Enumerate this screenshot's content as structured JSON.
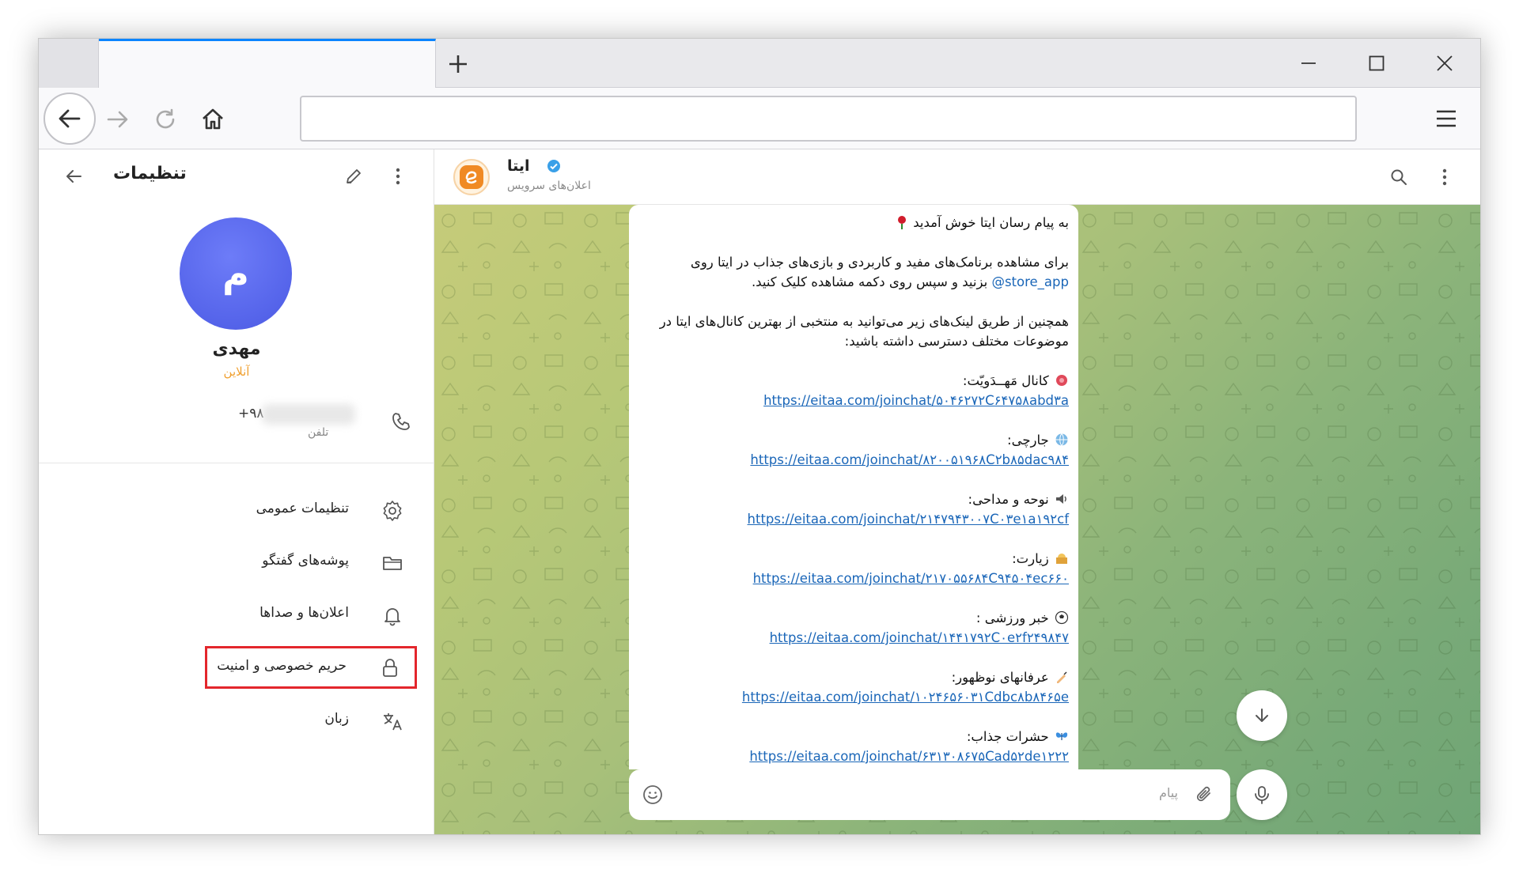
{
  "browser": {
    "new_tab_symbol": "+",
    "address": ""
  },
  "sidebar": {
    "title": "تنظیمات",
    "avatar_letter": "م",
    "user_name": "مهدی",
    "status": "آنلاین",
    "phone_prefix": "+۹۸",
    "phone_label": "تلفن",
    "items": [
      {
        "label": "تنظیمات عمومی",
        "icon": "gear-icon"
      },
      {
        "label": "پوشه‌های گفتگو",
        "icon": "folder-icon"
      },
      {
        "label": "اعلان‌ها و صداها",
        "icon": "bell-icon"
      },
      {
        "label": "حریم خصوصی و امنیت",
        "icon": "lock-icon",
        "highlighted": true
      },
      {
        "label": "زبان",
        "icon": "translate-icon"
      }
    ]
  },
  "chat": {
    "name": "ایتا",
    "subtitle": "اعلان‌های سرویس",
    "composer_placeholder": "پیام",
    "message": {
      "greeting": "به پیام رسان ایتا خوش آمدید",
      "para1_line1": "برای مشاهده برنامک‌های مفید و کاربردی و بازی‌های جذاب در ایتا روی",
      "para1_handle": "@store_app",
      "para1_line2": "بزنید و سپس روی دکمه مشاهده کلیک کنید.",
      "para2": "همچنین از طریق لینک‌های زیر می‌توانید به منتخبی از بهترین کانال‌های ایتا در موضوعات مختلف دسترسی داشته باشید:",
      "channels": [
        {
          "label": "کانال مَهــدَویّت:",
          "url": "https://eitaa.com/joinchat/۵۰۴۶۲۷۲C۶۴۷۵۸abd۳a"
        },
        {
          "label": "جارچی:",
          "url": "https://eitaa.com/joinchat/۸۲۰۰۵۱۹۶۸C۲b۸۵dac۹۸۴"
        },
        {
          "label": "نوحه و مداحی:",
          "url": "https://eitaa.com/joinchat/۲۱۴۷۹۴۳۰۰۷C۰۳e۱a۱۹۲cf"
        },
        {
          "label": "زیارت:",
          "url": "https://eitaa.com/joinchat/۲۱۷۰۵۵۶۸۴C۹۴۵۰۴ec۶۶۰"
        },
        {
          "label": "خبر ورزشی :",
          "url": "https://eitaa.com/joinchat/۱۴۴۱۷۹۲C۰e۲f۲۴۹۸۴۷"
        },
        {
          "label": "عرفانهای نوظهور:",
          "url": "https://eitaa.com/joinchat/۱۰۲۴۶۵۶۰۳۱Cdbc۸b۸۴۶۵e"
        },
        {
          "label": "حشرات جذاب:",
          "url": "https://eitaa.com/joinchat/۶۳۱۳۰۸۶۷۵Cad۵۲de۱۲۲۲"
        }
      ]
    }
  },
  "colors": {
    "accent_tab": "#0a84ff",
    "avatar": "#5a66ee",
    "status": "#f0a030",
    "highlight_border": "#e3262c",
    "link": "#1a66b8",
    "verified": "#3aa0e8"
  }
}
